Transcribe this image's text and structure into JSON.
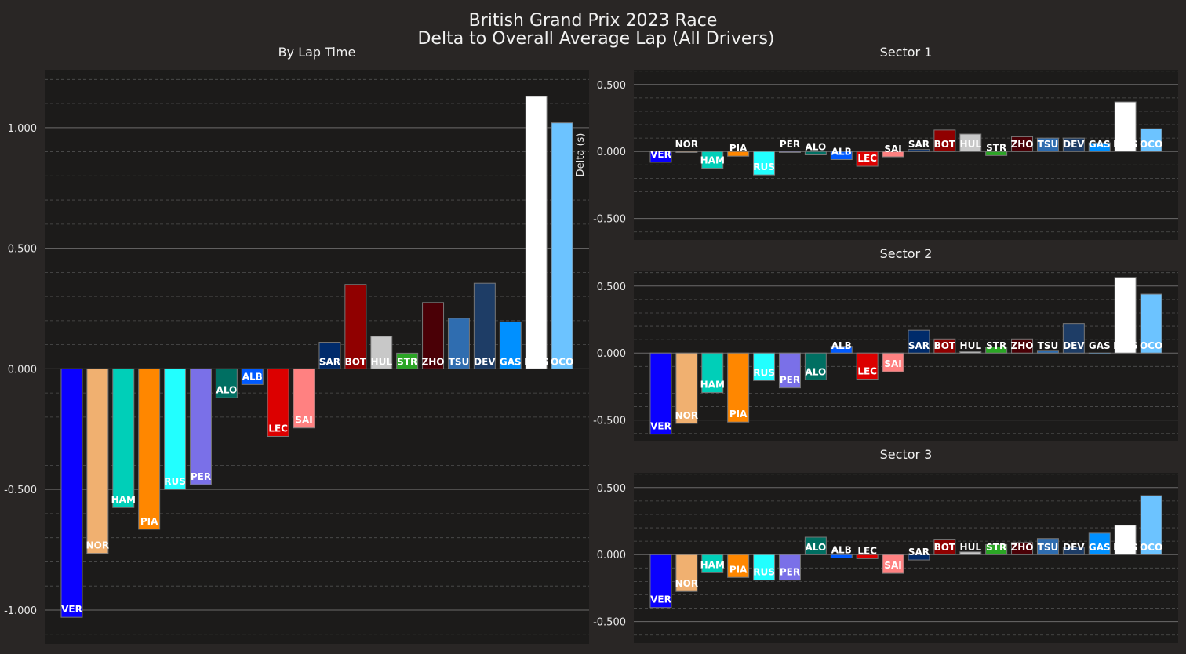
{
  "title": {
    "line1": "British Grand Prix 2023 Race",
    "line2": "Delta to Overall Average Lap (All Drivers)"
  },
  "colors": {
    "figure_bg": "#292625",
    "axes_bg": "#1c1b1a",
    "grid_major": "#6b6b6b",
    "grid_minor": "#4f4f4f",
    "bar_edge": "#777777"
  },
  "drivers": [
    "VER",
    "NOR",
    "HAM",
    "PIA",
    "RUS",
    "PER",
    "ALO",
    "ALB",
    "LEC",
    "SAI",
    "SAR",
    "BOT",
    "HUL",
    "STR",
    "ZHO",
    "TSU",
    "DEV",
    "GAS",
    "MAG",
    "OCO"
  ],
  "driver_colors": [
    "#0a00ff",
    "#f0b070",
    "#00cfb8",
    "#ff8700",
    "#22ffff",
    "#7a70e8",
    "#006f62",
    "#005aff",
    "#dc0000",
    "#ff8181",
    "#002b6b",
    "#900000",
    "#c8c8c8",
    "#2ba625",
    "#4a0006",
    "#2f6db0",
    "#1e3d66",
    "#0090ff",
    "#ffffff",
    "#6cc3ff"
  ],
  "chart_data": [
    {
      "type": "bar",
      "title": "By Lap Time",
      "categories": [
        "VER",
        "NOR",
        "HAM",
        "PIA",
        "RUS",
        "PER",
        "ALO",
        "ALB",
        "LEC",
        "SAI",
        "SAR",
        "BOT",
        "HUL",
        "STR",
        "ZHO",
        "TSU",
        "DEV",
        "GAS",
        "MAG",
        "OCO"
      ],
      "values": [
        -1.03,
        -0.765,
        -0.575,
        -0.665,
        -0.5,
        -0.48,
        -0.12,
        -0.065,
        -0.28,
        -0.245,
        0.11,
        0.35,
        0.135,
        0.065,
        0.275,
        0.21,
        0.355,
        0.195,
        1.13,
        1.02
      ],
      "ylim": [
        1.24,
        -1.14
      ],
      "y_inverted": true,
      "yticks": [
        -1.0,
        -0.5,
        0.0,
        0.5,
        1.0
      ],
      "ytick_labels": [
        "-1.000",
        "-0.500",
        "0.000",
        "0.500",
        "1.000"
      ],
      "ylabel": "",
      "grid": true
    },
    {
      "type": "bar",
      "title": "Sector 1",
      "categories": [
        "VER",
        "NOR",
        "HAM",
        "PIA",
        "RUS",
        "PER",
        "ALO",
        "ALB",
        "LEC",
        "SAI",
        "SAR",
        "BOT",
        "HUL",
        "STR",
        "ZHO",
        "TSU",
        "DEV",
        "GAS",
        "MAG",
        "OCO"
      ],
      "values": [
        -0.08,
        -0.005,
        -0.125,
        -0.035,
        -0.175,
        0.0,
        -0.025,
        -0.06,
        -0.11,
        -0.04,
        0.015,
        0.16,
        0.13,
        -0.03,
        0.11,
        0.1,
        0.1,
        0.065,
        0.37,
        0.17
      ],
      "ylim": [
        0.61,
        -0.66
      ],
      "y_inverted": true,
      "yticks": [
        -0.5,
        0.0,
        0.5
      ],
      "ytick_labels": [
        "-0.500",
        "0.000",
        "0.500"
      ],
      "ylabel": "Delta (s)",
      "grid": true
    },
    {
      "type": "bar",
      "title": "Sector 2",
      "categories": [
        "VER",
        "NOR",
        "HAM",
        "PIA",
        "RUS",
        "PER",
        "ALO",
        "ALB",
        "LEC",
        "SAI",
        "SAR",
        "BOT",
        "HUL",
        "STR",
        "ZHO",
        "TSU",
        "DEV",
        "GAS",
        "MAG",
        "OCO"
      ],
      "values": [
        -0.605,
        -0.525,
        -0.295,
        -0.515,
        -0.205,
        -0.26,
        -0.2,
        0.05,
        -0.195,
        -0.14,
        0.17,
        0.105,
        0.01,
        0.045,
        0.105,
        0.02,
        0.22,
        0.0,
        0.565,
        0.44
      ],
      "ylim": [
        0.61,
        -0.66
      ],
      "y_inverted": true,
      "yticks": [
        -0.5,
        0.0,
        0.5
      ],
      "ytick_labels": [
        "-0.500",
        "0.000",
        "0.500"
      ],
      "ylabel": "",
      "grid": true
    },
    {
      "type": "bar",
      "title": "Sector 3",
      "categories": [
        "VER",
        "NOR",
        "HAM",
        "PIA",
        "RUS",
        "PER",
        "ALO",
        "ALB",
        "LEC",
        "SAI",
        "SAR",
        "BOT",
        "HUL",
        "STR",
        "ZHO",
        "TSU",
        "DEV",
        "GAS",
        "MAG",
        "OCO"
      ],
      "values": [
        -0.395,
        -0.275,
        -0.135,
        -0.17,
        -0.19,
        -0.19,
        0.13,
        -0.025,
        -0.03,
        -0.14,
        -0.04,
        0.115,
        0.02,
        0.075,
        0.09,
        0.12,
        0.055,
        0.16,
        0.22,
        0.44
      ],
      "ylim": [
        0.61,
        -0.66
      ],
      "y_inverted": true,
      "yticks": [
        -0.5,
        0.0,
        0.5
      ],
      "ytick_labels": [
        "-0.500",
        "0.000",
        "0.500"
      ],
      "ylabel": "",
      "grid": true
    }
  ]
}
